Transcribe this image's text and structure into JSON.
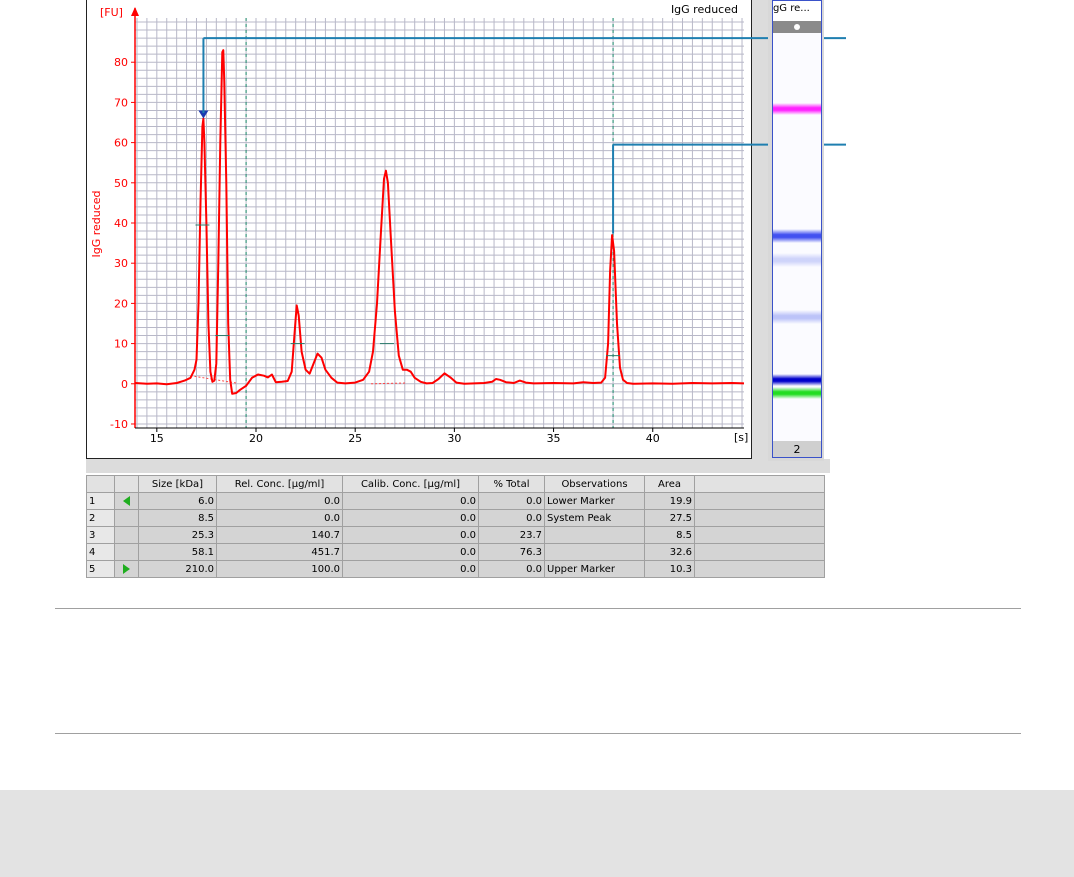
{
  "chart_data": {
    "type": "line",
    "title": "IgG reduced",
    "ylabel": "IgG reduced",
    "yunit": "[FU]",
    "xunit": "[s]",
    "xlim": [
      13.9,
      44.6
    ],
    "ylim": [
      -11,
      91
    ],
    "xticks": [
      15,
      20,
      25,
      30,
      35,
      40
    ],
    "yticks": [
      -10,
      0,
      10,
      20,
      30,
      40,
      50,
      60,
      70,
      80
    ],
    "grid": true,
    "series": [
      {
        "color": "#ff0000",
        "points": [
          [
            13.9,
            0.2
          ],
          [
            14.5,
            0.0
          ],
          [
            15.0,
            0.1
          ],
          [
            15.5,
            -0.1
          ],
          [
            16.0,
            0.2
          ],
          [
            16.4,
            0.8
          ],
          [
            16.7,
            1.5
          ],
          [
            16.9,
            3.5
          ],
          [
            17.0,
            6
          ],
          [
            17.1,
            20
          ],
          [
            17.2,
            45
          ],
          [
            17.3,
            64
          ],
          [
            17.35,
            66
          ],
          [
            17.4,
            60
          ],
          [
            17.5,
            40
          ],
          [
            17.6,
            15
          ],
          [
            17.7,
            3
          ],
          [
            17.8,
            0.5
          ],
          [
            17.9,
            0.8
          ],
          [
            18.0,
            5
          ],
          [
            18.1,
            30
          ],
          [
            18.2,
            60
          ],
          [
            18.3,
            82.5
          ],
          [
            18.35,
            83
          ],
          [
            18.4,
            75
          ],
          [
            18.5,
            50
          ],
          [
            18.6,
            15
          ],
          [
            18.7,
            1
          ],
          [
            18.8,
            -2.5
          ],
          [
            19.0,
            -2.3
          ],
          [
            19.2,
            -1.5
          ],
          [
            19.5,
            -0.5
          ],
          [
            19.8,
            1.5
          ],
          [
            20.1,
            2.3
          ],
          [
            20.4,
            2.0
          ],
          [
            20.6,
            1.6
          ],
          [
            20.8,
            2.3
          ],
          [
            21.0,
            0.4
          ],
          [
            21.3,
            0.5
          ],
          [
            21.6,
            0.7
          ],
          [
            21.8,
            3
          ],
          [
            21.95,
            13
          ],
          [
            22.05,
            19.5
          ],
          [
            22.15,
            17
          ],
          [
            22.3,
            8
          ],
          [
            22.5,
            3.5
          ],
          [
            22.7,
            2.5
          ],
          [
            22.9,
            5
          ],
          [
            23.1,
            7.5
          ],
          [
            23.3,
            6.5
          ],
          [
            23.5,
            3.5
          ],
          [
            23.8,
            1.5
          ],
          [
            24.1,
            0.3
          ],
          [
            24.5,
            0.1
          ],
          [
            25.0,
            0.3
          ],
          [
            25.4,
            1
          ],
          [
            25.7,
            3
          ],
          [
            25.9,
            8
          ],
          [
            26.1,
            20
          ],
          [
            26.3,
            38
          ],
          [
            26.45,
            51
          ],
          [
            26.55,
            53
          ],
          [
            26.65,
            50
          ],
          [
            26.8,
            36
          ],
          [
            27.0,
            18
          ],
          [
            27.2,
            7
          ],
          [
            27.4,
            3.5
          ],
          [
            27.6,
            3.5
          ],
          [
            27.8,
            3
          ],
          [
            28.0,
            1.5
          ],
          [
            28.3,
            0.5
          ],
          [
            28.6,
            0.1
          ],
          [
            28.9,
            0.2
          ],
          [
            29.2,
            1.2
          ],
          [
            29.5,
            2.6
          ],
          [
            29.8,
            1.6
          ],
          [
            30.1,
            0.3
          ],
          [
            30.5,
            0.0
          ],
          [
            31.0,
            0.1
          ],
          [
            31.5,
            0.2
          ],
          [
            31.9,
            0.5
          ],
          [
            32.1,
            1.2
          ],
          [
            32.3,
            1.0
          ],
          [
            32.6,
            0.4
          ],
          [
            33.0,
            0.2
          ],
          [
            33.3,
            0.8
          ],
          [
            33.6,
            0.3
          ],
          [
            34.0,
            0.1
          ],
          [
            35.0,
            0.2
          ],
          [
            36.0,
            0.1
          ],
          [
            36.5,
            0.4
          ],
          [
            37.0,
            0.2
          ],
          [
            37.4,
            0.3
          ],
          [
            37.6,
            1.5
          ],
          [
            37.75,
            10
          ],
          [
            37.85,
            28
          ],
          [
            37.95,
            37
          ],
          [
            38.05,
            33
          ],
          [
            38.2,
            15
          ],
          [
            38.35,
            4
          ],
          [
            38.5,
            1
          ],
          [
            38.7,
            0.2
          ],
          [
            39.0,
            0.0
          ],
          [
            40.0,
            0.1
          ],
          [
            41.0,
            0.0
          ],
          [
            42.0,
            0.2
          ],
          [
            43.0,
            0.1
          ],
          [
            44.0,
            0.2
          ],
          [
            44.6,
            0.1
          ]
        ]
      }
    ],
    "vlines_x": [
      19.5,
      38.0
    ],
    "peak_markers": [
      {
        "x": 17.3,
        "y": 39.5
      },
      {
        "x": 18.3,
        "y": 12
      },
      {
        "x": 22.1,
        "y": 10
      },
      {
        "x": 26.6,
        "y": 10
      },
      {
        "x": 38.0,
        "y": 7
      }
    ],
    "peak_baselines": [
      [
        16.7,
        19.0,
        2.0
      ],
      [
        25.8,
        27.6,
        0.0
      ]
    ],
    "selected_peak": {
      "x": 17.35,
      "y": 66
    },
    "callout_peaks": [
      {
        "x": 17.35,
        "y": 86
      },
      {
        "x": 38.0,
        "y": 59.5
      }
    ]
  },
  "lane": {
    "header": "IgG re...",
    "footer": "2",
    "bands": [
      {
        "pos": 0.187,
        "color": "#ff22ff",
        "strength": 1.0
      },
      {
        "pos": 0.498,
        "color": "#2233ee",
        "strength": 0.85
      },
      {
        "pos": 0.557,
        "color": "#6677ee",
        "strength": 0.3
      },
      {
        "pos": 0.695,
        "color": "#6f7ff0",
        "strength": 0.45
      },
      {
        "pos": 0.85,
        "color": "#0000cc",
        "strength": 1.0
      },
      {
        "pos": 0.883,
        "color": "#22dd22",
        "strength": 1.0
      }
    ]
  },
  "table": {
    "headers": [
      "",
      "",
      "Size [kDa]",
      "Rel. Conc. [µg/ml]",
      "Calib. Conc. [µg/ml]",
      "% Total",
      "Observations",
      "Area",
      ""
    ],
    "rows": [
      {
        "idx": "1",
        "marker": "left",
        "size": "6.0",
        "rel": "0.0",
        "calib": "0.0",
        "total": "0.0",
        "obs": "Lower Marker",
        "area": "19.9"
      },
      {
        "idx": "2",
        "marker": "",
        "size": "8.5",
        "rel": "0.0",
        "calib": "0.0",
        "total": "0.0",
        "obs": "System Peak",
        "area": "27.5"
      },
      {
        "idx": "3",
        "marker": "",
        "size": "25.3",
        "rel": "140.7",
        "calib": "0.0",
        "total": "23.7",
        "obs": "",
        "area": "8.5"
      },
      {
        "idx": "4",
        "marker": "",
        "size": "58.1",
        "rel": "451.7",
        "calib": "0.0",
        "total": "76.3",
        "obs": "",
        "area": "32.6"
      },
      {
        "idx": "5",
        "marker": "right",
        "size": "210.0",
        "rel": "100.0",
        "calib": "0.0",
        "total": "0.0",
        "obs": "Upper Marker",
        "area": "10.3"
      }
    ]
  },
  "colors": {
    "trace": "#ff0000",
    "grid": "#b8b8c8",
    "callout": "#1f7fb0",
    "accent": "#0000ff"
  }
}
